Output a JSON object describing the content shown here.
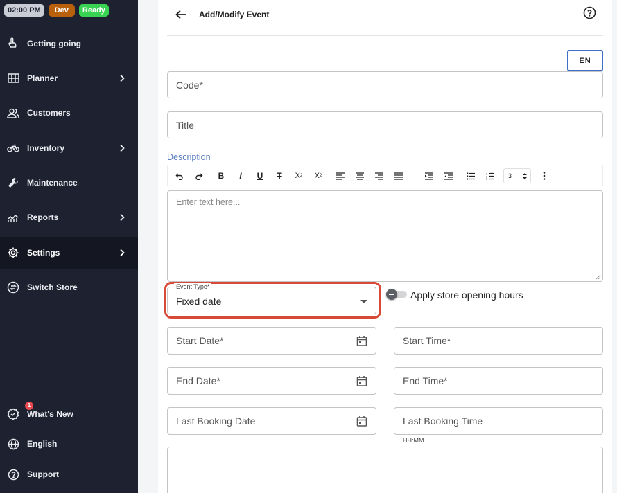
{
  "status": {
    "time": "02:00 PM",
    "env": "Dev",
    "state": "Ready"
  },
  "sidebar": {
    "items": [
      {
        "label": "Getting going",
        "icon": "hand-pointer-icon",
        "chevron": false
      },
      {
        "label": "Planner",
        "icon": "grid-icon",
        "chevron": true
      },
      {
        "label": "Customers",
        "icon": "users-icon",
        "chevron": false
      },
      {
        "label": "Inventory",
        "icon": "bicycle-icon",
        "chevron": true
      },
      {
        "label": "Maintenance",
        "icon": "wrench-icon",
        "chevron": false
      },
      {
        "label": "Reports",
        "icon": "chart-icon",
        "chevron": true
      },
      {
        "label": "Settings",
        "icon": "gear-icon",
        "chevron": true,
        "active": true
      },
      {
        "label": "Switch Store",
        "icon": "switch-icon",
        "chevron": false
      }
    ],
    "bottom": [
      {
        "label": "What's New",
        "icon": "badge-check-icon",
        "notification": "1"
      },
      {
        "label": "English",
        "icon": "globe-icon"
      },
      {
        "label": "Support",
        "icon": "question-icon"
      }
    ]
  },
  "header": {
    "title": "Add/Modify Event"
  },
  "form": {
    "language": "EN",
    "code_placeholder": "Code*",
    "title_placeholder": "Title",
    "description_label": "Description",
    "editor_placeholder": "Enter text here...",
    "heading_level": "3",
    "event_type_label": "Event Type*",
    "event_type_value": "Fixed date",
    "apply_hours_label": "Apply store opening hours",
    "apply_hours_on": false,
    "start_date": "Start Date*",
    "start_time": "Start Time*",
    "end_date": "End Date*",
    "end_time": "End Time*",
    "last_booking_date": "Last Booking Date",
    "last_booking_time": "Last Booking Time",
    "time_hint": "HH:MM"
  },
  "colors": {
    "sidebar_bg": "#1e2130",
    "accent_blue": "#3f6fc2",
    "highlight_red": "#d84a38",
    "ready_green": "#39d353",
    "dev_orange": "#b8600c"
  }
}
